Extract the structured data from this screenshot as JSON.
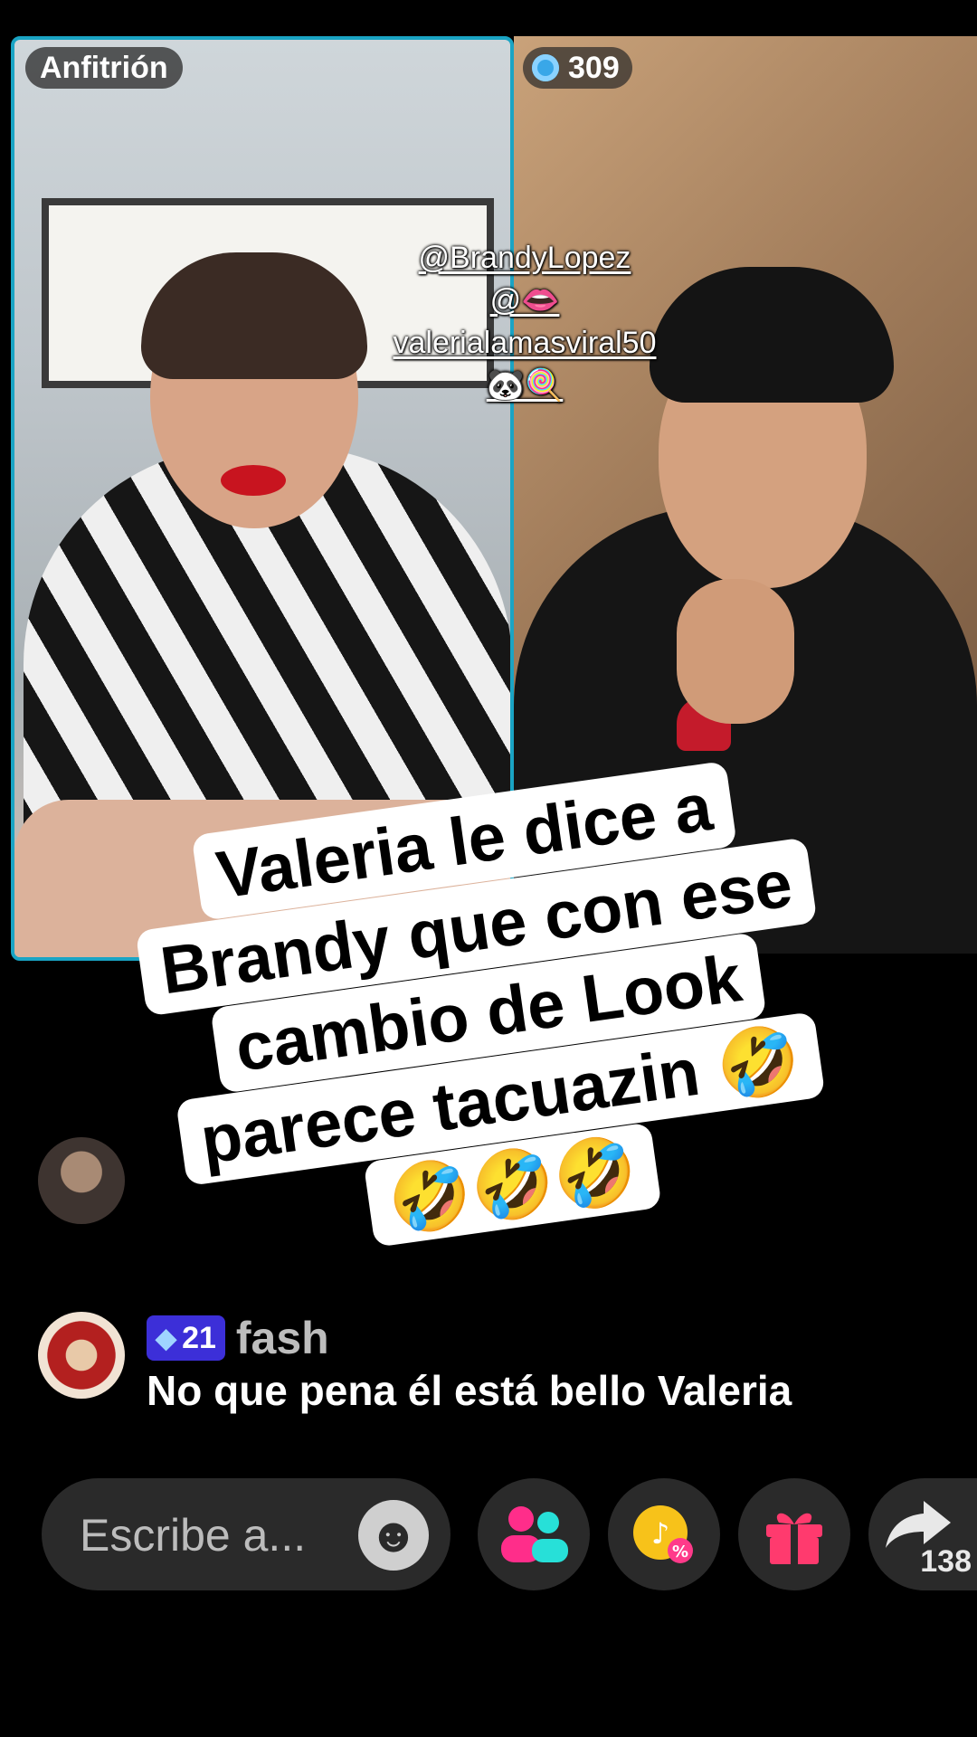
{
  "host_badge": "Anfitrión",
  "score_badge": "309",
  "mentions": [
    "@BrandyLopez",
    "@👄",
    "valerialamasviral50",
    "🐼🍭"
  ],
  "caption": {
    "line1": "Valeria le dice a",
    "line2": "Brandy que con ese",
    "line3": "cambio de Look",
    "line4": "parece tacuazin 🤣",
    "line5": "🤣🤣🤣"
  },
  "chat": {
    "gift_level": "21",
    "username": "fash",
    "message": "No que pena él está bello Valeria"
  },
  "bottom_bar": {
    "input_placeholder": "Escribe a...",
    "share_count": "138"
  },
  "colors": {
    "host_border": "#1aa4c4",
    "gift_badge": "#3c2fd8",
    "people_icon_pink": "#ff2d8a",
    "people_icon_teal": "#27e0d8",
    "gift_icon": "#ff3a6e",
    "coin_icon": "#f7c21a"
  }
}
